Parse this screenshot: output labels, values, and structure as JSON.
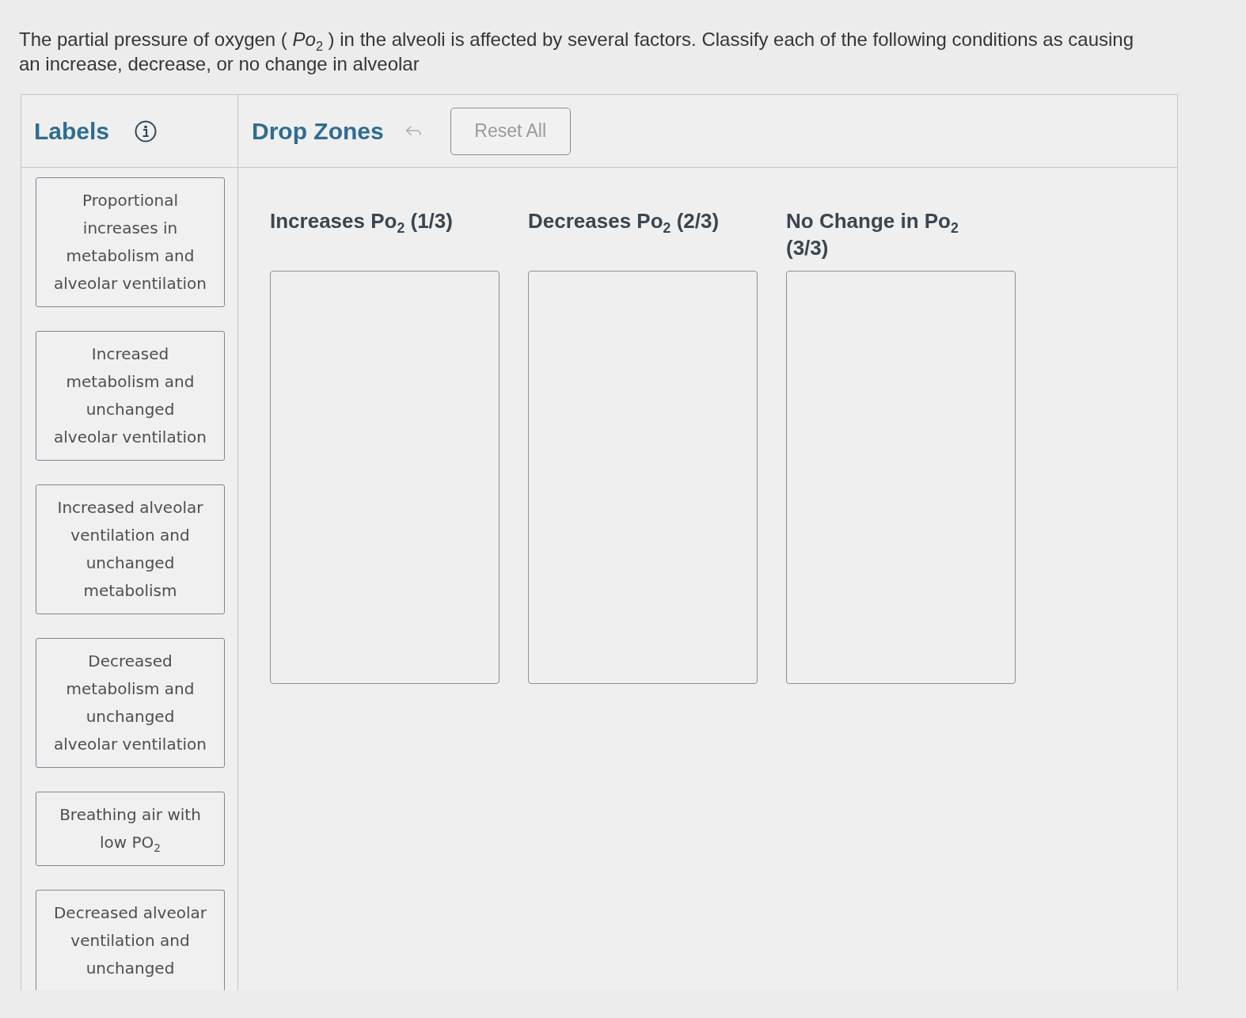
{
  "question": "The partial pressure of oxygen ( *Po*$_{2}$ ) in the alveoli is affected by several factors. Classify each of the following conditions as causing an increase, decrease, or no change in alveolar",
  "labels": {
    "title": "Labels",
    "items": [
      "Proportional increases in metabolism and alveolar ventilation",
      "Increased metabolism and unchanged alveolar ventilation",
      "Increased alveolar ventilation and unchanged metabolism",
      "Decreased metabolism and unchanged alveolar ventilation",
      "Breathing air with low PO$_{2}$",
      "Decreased alveolar ventilation and unchanged"
    ]
  },
  "drop_zones": {
    "title": "Drop Zones",
    "undo_button": {
      "disabled": true
    },
    "reset_button": {
      "label": "Reset All",
      "disabled": true
    },
    "zones": [
      {
        "heading": "Increases Po$_{2}$ (1/3)"
      },
      {
        "heading": "Decreases Po$_{2}$ (2/3)"
      },
      {
        "heading": "No Change in Po$_{2}$ (3/3)"
      }
    ]
  }
}
